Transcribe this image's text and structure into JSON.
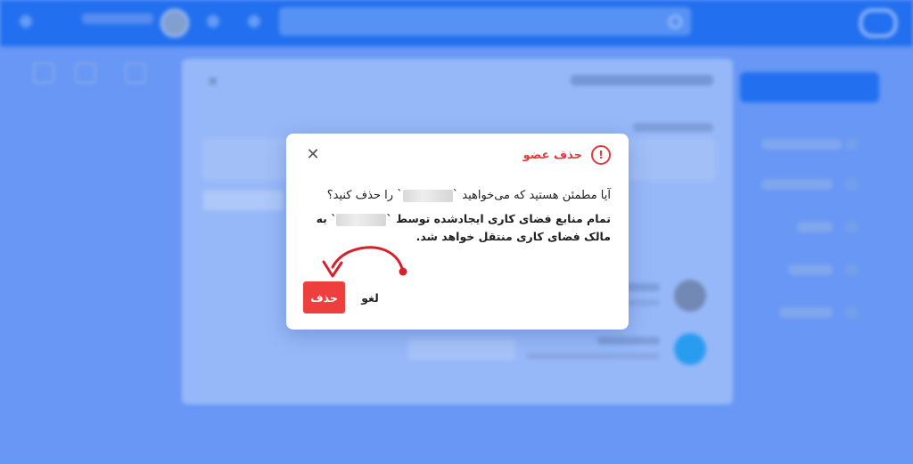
{
  "modal": {
    "title": "حذف عضو",
    "question_before": "آیا مطمئن هستید که می‌خواهید `",
    "question_after": "` را حذف کنید؟",
    "warning_before": "تمام منابع فضای کاری ایجادشده توسط `",
    "warning_after": "` به مالک فضای کاری منتقل خواهد شد.",
    "delete_label": "حذف",
    "cancel_label": "لغو",
    "close_symbol": "✕",
    "alert_symbol": "!"
  },
  "colors": {
    "danger": "#ee3f3f",
    "primary": "#1a6cf0",
    "annotation_arrow": "#d6202a"
  },
  "icons": [
    "alert-circle-icon",
    "close-icon",
    "annotation-arrow-icon"
  ]
}
